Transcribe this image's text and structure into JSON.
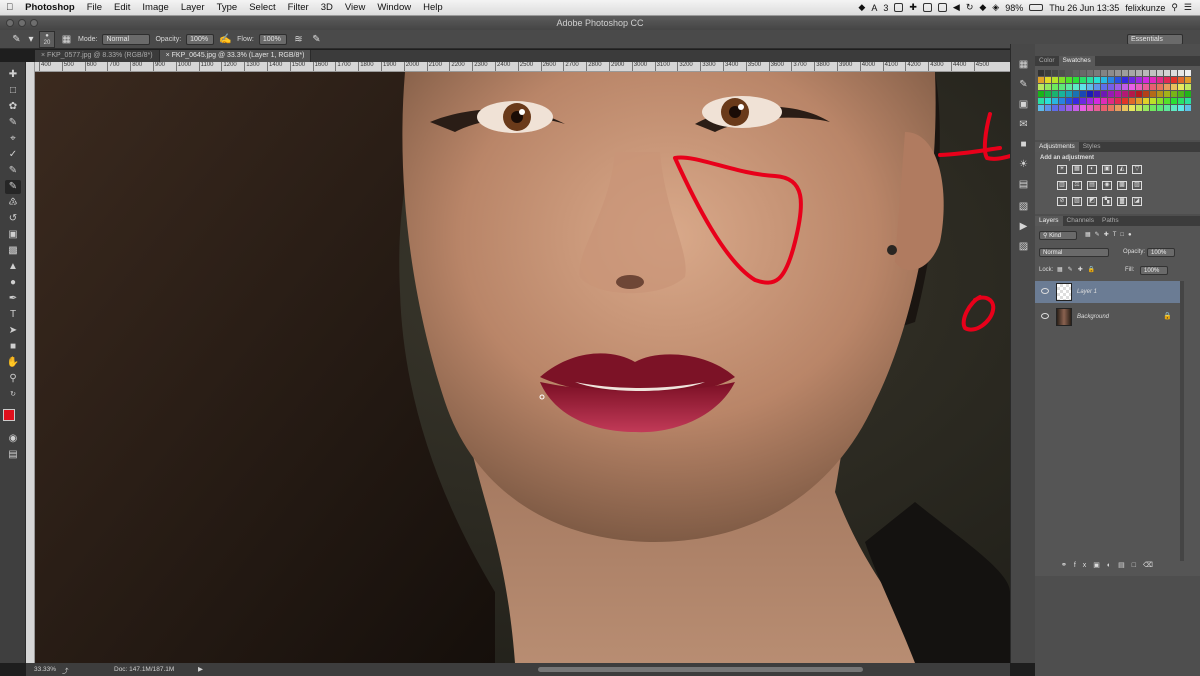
{
  "menubar": {
    "app": "Photoshop",
    "items": [
      "File",
      "Edit",
      "Image",
      "Layer",
      "Type",
      "Select",
      "Filter",
      "3D",
      "View",
      "Window",
      "Help"
    ],
    "status_num": "3",
    "battery": "98%",
    "datetime": "Thu 26 Jun 13:35",
    "user": "felixkunze"
  },
  "window": {
    "title": "Adobe Photoshop CC"
  },
  "options": {
    "brush_size": "20",
    "mode_label": "Mode:",
    "mode_value": "Normal",
    "opacity_label": "Opacity:",
    "opacity_value": "100%",
    "flow_label": "Flow:",
    "flow_value": "100%",
    "workspace": "Essentials"
  },
  "doc_tabs": [
    {
      "label": "FKP_0577.jpg @ 8.33% (RGB/8*)"
    },
    {
      "label": "FKP_0645.jpg @ 33.3% (Layer 1, RGB/8*)"
    }
  ],
  "ruler_ticks": [
    "400",
    "500",
    "600",
    "700",
    "800",
    "900",
    "1000",
    "1100",
    "1200",
    "1300",
    "1400",
    "1500",
    "1600",
    "1700",
    "1800",
    "1900",
    "2000",
    "2100",
    "2200",
    "2300",
    "2400",
    "2500",
    "2600",
    "2700",
    "2800",
    "2900",
    "3000",
    "3100",
    "3200",
    "3300",
    "3400",
    "3500",
    "3600",
    "3700",
    "3800",
    "3900",
    "4000",
    "4100",
    "4200",
    "4300",
    "4400",
    "4500"
  ],
  "panels": {
    "color_tabs": [
      "Color",
      "Swatches"
    ],
    "adjust_tabs": [
      "Adjustments",
      "Styles"
    ],
    "adjust_heading": "Add an adjustment",
    "layers_tabs": [
      "Layers",
      "Channels",
      "Paths"
    ],
    "kind_label": "Kind",
    "blend_mode": "Normal",
    "opacity_label": "Opacity:",
    "opacity_value": "100%",
    "lock_label": "Lock:",
    "fill_label": "Fill:",
    "fill_value": "100%",
    "layers": [
      {
        "name": "Layer 1",
        "selected": true
      },
      {
        "name": "Background",
        "selected": false
      }
    ]
  },
  "status": {
    "zoom": "33.33%",
    "doc": "Doc: 147.1M/187.1M"
  },
  "colors": {
    "foreground": "#e0101c",
    "background": "#ffffff",
    "annotation": "#e8001a"
  }
}
